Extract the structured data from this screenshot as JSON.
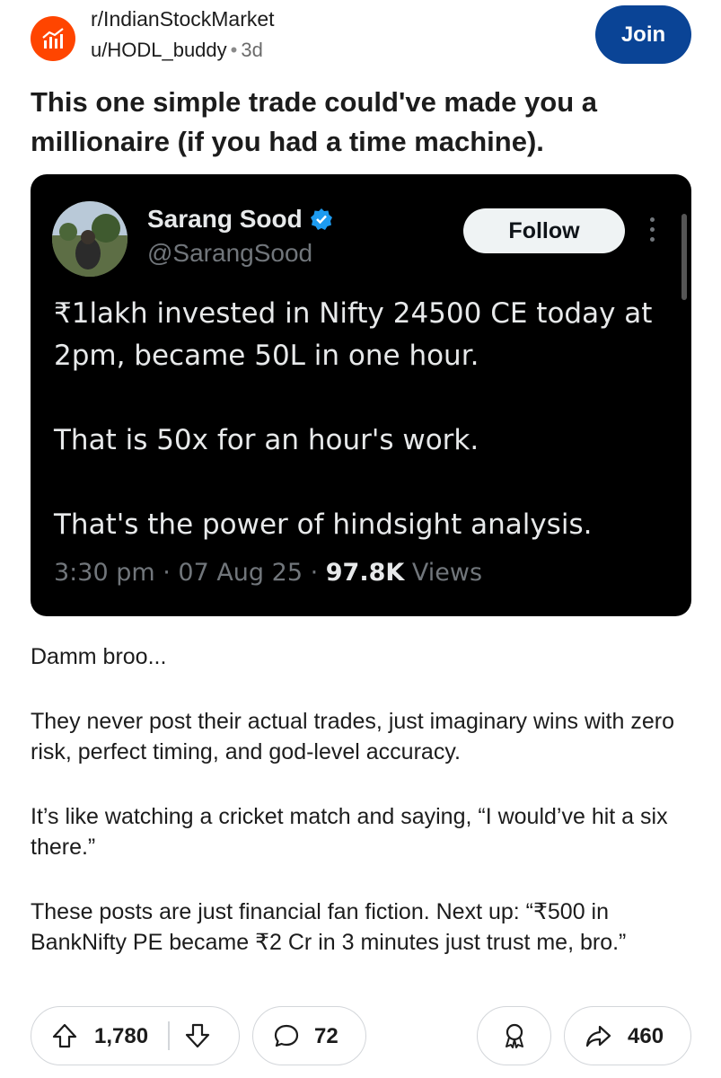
{
  "post": {
    "subreddit": "r/IndianStockMarket",
    "author": "u/HODL_buddy",
    "separator": "•",
    "age": "3d",
    "join_label": "Join",
    "title": "This one simple trade could've made you a millionaire (if you had a time machine)."
  },
  "tweet": {
    "name": "Sarang Sood",
    "handle": "@SarangSood",
    "follow_label": "Follow",
    "paragraphs": [
      "₹1lakh invested in Nifty 24500 CE today at 2pm, became 50L in one hour.",
      "That is 50x for an hour's work.",
      "That's the power of hindsight analysis."
    ],
    "meta_time": "3:30 pm · 07 Aug 25 · ",
    "views_count": "97.8K",
    "views_label": " Views"
  },
  "body": {
    "paragraphs": [
      "Damm broo...",
      "They never post their actual trades, just imaginary wins with zero risk, perfect timing, and god-level accuracy.",
      "It’s like watching a cricket match and saying, “I would’ve hit a six there.”",
      "These posts are just financial fan fiction. Next up: “₹500 in BankNifty PE became ₹2 Cr in 3 minutes just trust me, bro.”"
    ]
  },
  "actions": {
    "upvotes": "1,780",
    "comments": "72",
    "shares": "460"
  },
  "colors": {
    "subreddit_icon": "#ff4500",
    "join_button": "#0a4496",
    "tweet_background": "#000000",
    "verified_badge": "#1d9bf0"
  },
  "icons": [
    "chart-icon",
    "verified-icon",
    "more-icon",
    "upvote-icon",
    "downvote-icon",
    "comment-icon",
    "award-icon",
    "share-icon"
  ]
}
